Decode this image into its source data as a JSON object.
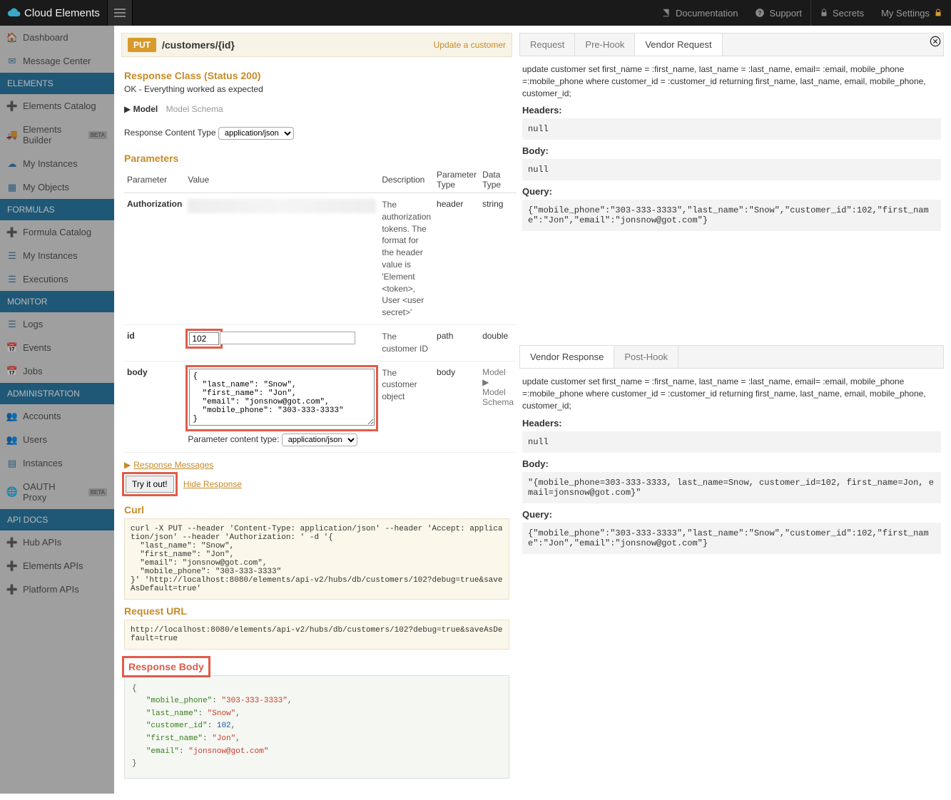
{
  "brand": "Cloud Elements",
  "topnav": {
    "documentation": "Documentation",
    "support": "Support",
    "secrets": "Secrets",
    "my_settings": "My Settings"
  },
  "sidebar": {
    "dashboard": "Dashboard",
    "message_center": "Message Center",
    "groups": {
      "elements": "ELEMENTS",
      "elements_items": [
        "Elements Catalog",
        "Elements Builder",
        "My Instances",
        "My Objects"
      ],
      "formulas": "FORMULAS",
      "formulas_items": [
        "Formula Catalog",
        "My Instances",
        "Executions"
      ],
      "monitor": "MONITOR",
      "monitor_items": [
        "Logs",
        "Events",
        "Jobs"
      ],
      "administration": "ADMINISTRATION",
      "administration_items": [
        "Accounts",
        "Users",
        "Instances",
        "OAUTH Proxy"
      ],
      "api_docs": "API DOCS",
      "api_docs_items": [
        "Hub APIs",
        "Elements APIs",
        "Platform APIs"
      ]
    },
    "beta": "BETA"
  },
  "operation": {
    "method": "PUT",
    "path": "/customers/{id}",
    "summary": "Update a customer",
    "response_class_heading": "Response Class (Status 200)",
    "response_class_text": "OK - Everything worked as expected",
    "model_label": "Model",
    "model_schema_label": "Model Schema",
    "content_type_label": "Response Content Type",
    "content_type_value": "application/json",
    "parameters_heading": "Parameters",
    "param_headers": {
      "param": "Parameter",
      "value": "Value",
      "desc": "Description",
      "ptype": "Parameter Type",
      "dtype": "Data Type"
    },
    "params": {
      "authorization": {
        "name": "Authorization",
        "desc": "The authorization tokens. The format for the header value is 'Element <token>, User <user secret>'",
        "ptype": "header",
        "dtype": "string"
      },
      "id": {
        "name": "id",
        "value": "102",
        "desc": "The customer ID",
        "ptype": "path",
        "dtype": "double"
      },
      "body": {
        "name": "body",
        "value": "{\n  \"last_name\": \"Snow\",\n  \"first_name\": \"Jon\",\n  \"email\": \"jonsnow@got.com\",\n  \"mobile_phone\": \"303-333-3333\"\n}",
        "desc": "The customer object",
        "ptype": "body",
        "model": "Model",
        "model_schema": "Model Schema"
      }
    },
    "param_content_type_label": "Parameter content type:",
    "param_content_type_value": "application/json",
    "response_messages_heading": "Response Messages",
    "try_it_out": "Try it out!",
    "hide_response": "Hide Response",
    "curl_heading": "Curl",
    "curl_text": "curl -X PUT --header 'Content-Type: application/json' --header 'Accept: application/json' --header 'Authorization: ' -d '{\n  \"last_name\": \"Snow\",\n  \"first_name\": \"Jon\",\n  \"email\": \"jonsnow@got.com\",\n  \"mobile_phone\": \"303-333-3333\"\n}' 'http://localhost:8080/elements/api-v2/hubs/db/customers/102?debug=true&saveAsDefault=true'",
    "request_url_heading": "Request URL",
    "request_url_text": "http://localhost:8080/elements/api-v2/hubs/db/customers/102?debug=true&saveAsDefault=true",
    "response_body_heading": "Response Body"
  },
  "response_body_json": {
    "mobile_phone": "303-333-3333",
    "last_name": "Snow",
    "customer_id": 102,
    "first_name": "Jon",
    "email": "jonsnow@got.com"
  },
  "debug": {
    "tabs": {
      "request": "Request",
      "prehook": "Pre-Hook",
      "vendor_request": "Vendor Request",
      "vendor_response": "Vendor Response",
      "posthook": "Post-Hook"
    },
    "sql": "update customer set first_name = :first_name, last_name = :last_name, email= :email, mobile_phone =:mobile_phone where customer_id = :customer_id returning first_name, last_name, email, mobile_phone, customer_id;",
    "headers_label": "Headers:",
    "body_label": "Body:",
    "query_label": "Query:",
    "null": "null",
    "request_query": "{\"mobile_phone\":\"303-333-3333\",\"last_name\":\"Snow\",\"customer_id\":102,\"first_name\":\"Jon\",\"email\":\"jonsnow@got.com\"}",
    "response_body": "\"{mobile_phone=303-333-3333, last_name=Snow, customer_id=102, first_name=Jon, email=jonsnow@got.com}\"",
    "response_query": "{\"mobile_phone\":\"303-333-3333\",\"last_name\":\"Snow\",\"customer_id\":102,\"first_name\":\"Jon\",\"email\":\"jonsnow@got.com\"}"
  }
}
